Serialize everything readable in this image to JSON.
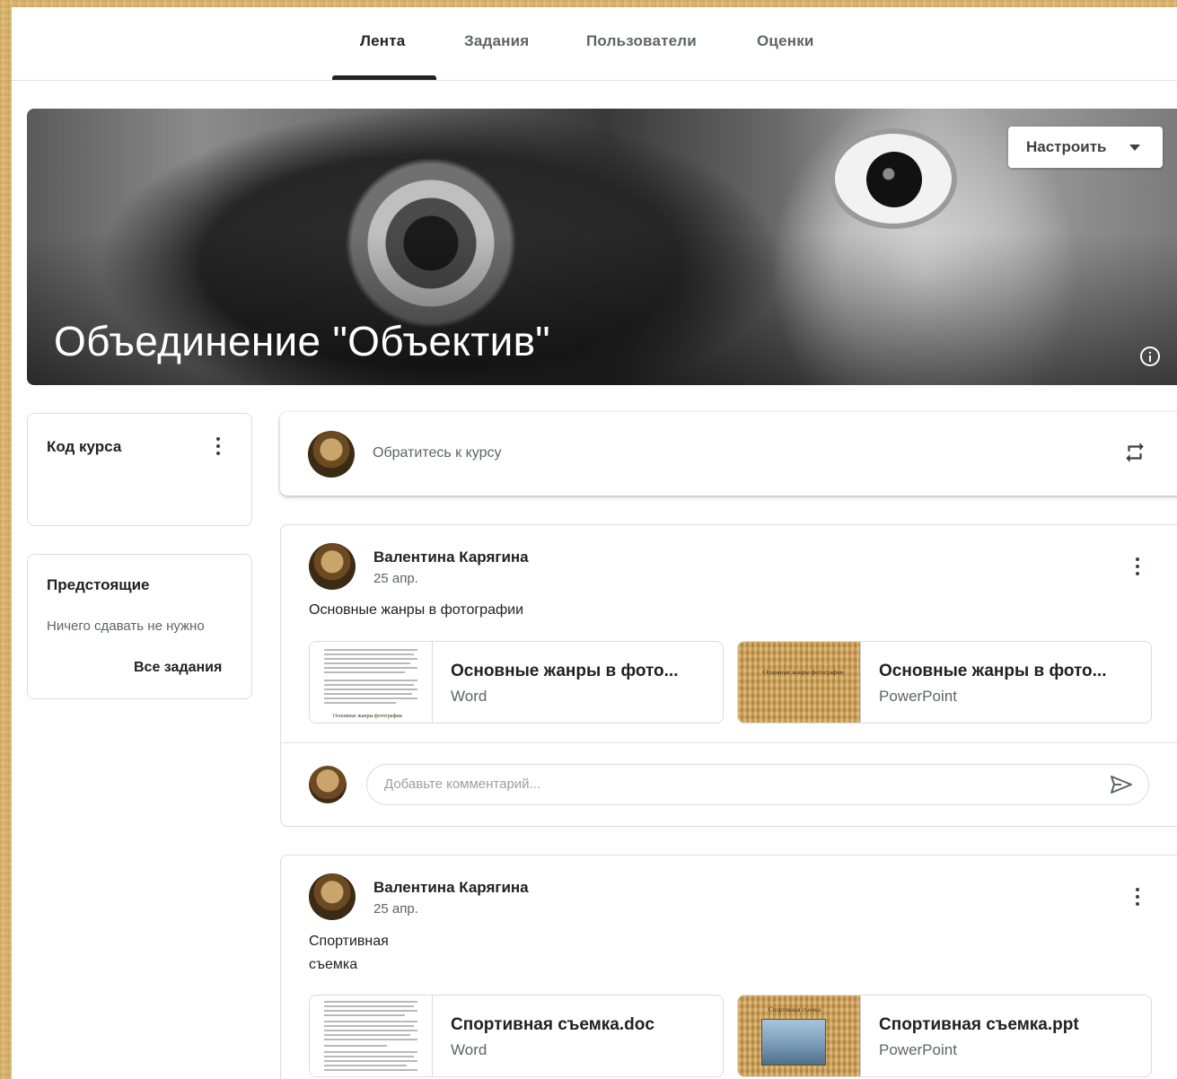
{
  "nav": {
    "tabs": [
      {
        "label": "Лента",
        "active": true
      },
      {
        "label": "Задания",
        "active": false
      },
      {
        "label": "Пользователи",
        "active": false
      },
      {
        "label": "Оценки",
        "active": false
      }
    ]
  },
  "banner": {
    "title": "Объединение \"Объектив\"",
    "customize_label": "Настроить"
  },
  "sidebar": {
    "course_code": {
      "title": "Код курса"
    },
    "upcoming": {
      "title": "Предстоящие",
      "empty_text": "Ничего сдавать не нужно",
      "all_link": "Все задания"
    }
  },
  "stream": {
    "announce_placeholder": "Обратитесь к курсу",
    "posts": [
      {
        "author": "Валентина Карягина",
        "date": "25 апр.",
        "text": [
          "Основные жанры в фотографии"
        ],
        "attachments": [
          {
            "name": "Основные жанры в фото...",
            "type": "Word",
            "thumb_caption": "Основные жанры фотографии"
          },
          {
            "name": "Основные жанры в фото...",
            "type": "PowerPoint",
            "thumb_caption": "Основные жанры фотографии"
          }
        ],
        "comment_placeholder": "Добавьте комментарий..."
      },
      {
        "author": "Валентина Карягина",
        "date": "25 апр.",
        "text": [
          "Спортивная",
          "съемка"
        ],
        "attachments": [
          {
            "name": "Спортивная съемка.doc",
            "type": "Word",
            "thumb_caption": ""
          },
          {
            "name": "Спортивная съемка.ppt",
            "type": "PowerPoint",
            "thumb_caption": "Спортивная съемка"
          }
        ]
      }
    ]
  },
  "colors": {
    "page_bg": "#d9b56e",
    "text_primary": "#202124",
    "text_secondary": "#5f6368",
    "border": "#dadce0"
  },
  "icons": [
    "kebab-menu-icon",
    "repost-icon",
    "send-icon",
    "info-icon",
    "caret-down-icon"
  ]
}
